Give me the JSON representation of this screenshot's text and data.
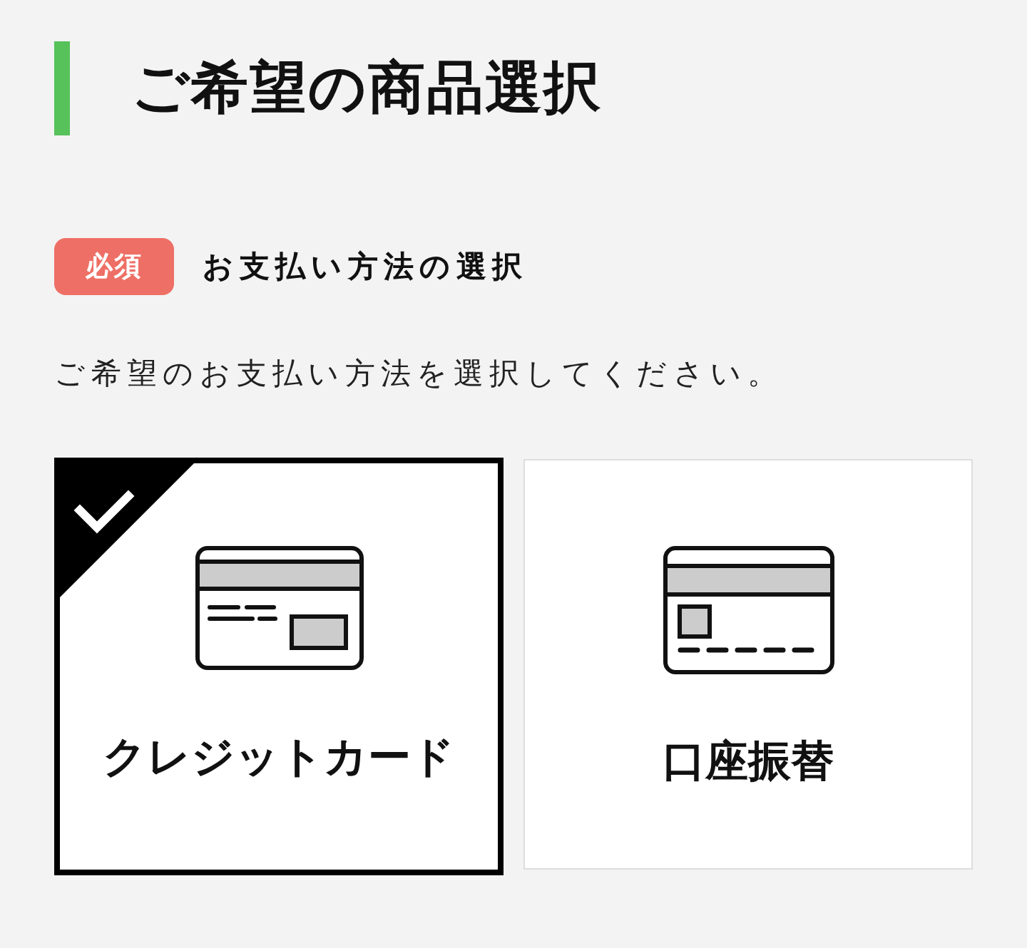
{
  "heading": {
    "title": "ご希望の商品選択"
  },
  "field": {
    "required_badge": "必須",
    "label": "お支払い方法の選択",
    "description": "ご希望のお支払い方法を選択してください。"
  },
  "payment_options": [
    {
      "label": "クレジットカード",
      "kind": "credit-card",
      "selected": true
    },
    {
      "label": "口座振替",
      "kind": "bank-transfer",
      "selected": false
    }
  ]
}
